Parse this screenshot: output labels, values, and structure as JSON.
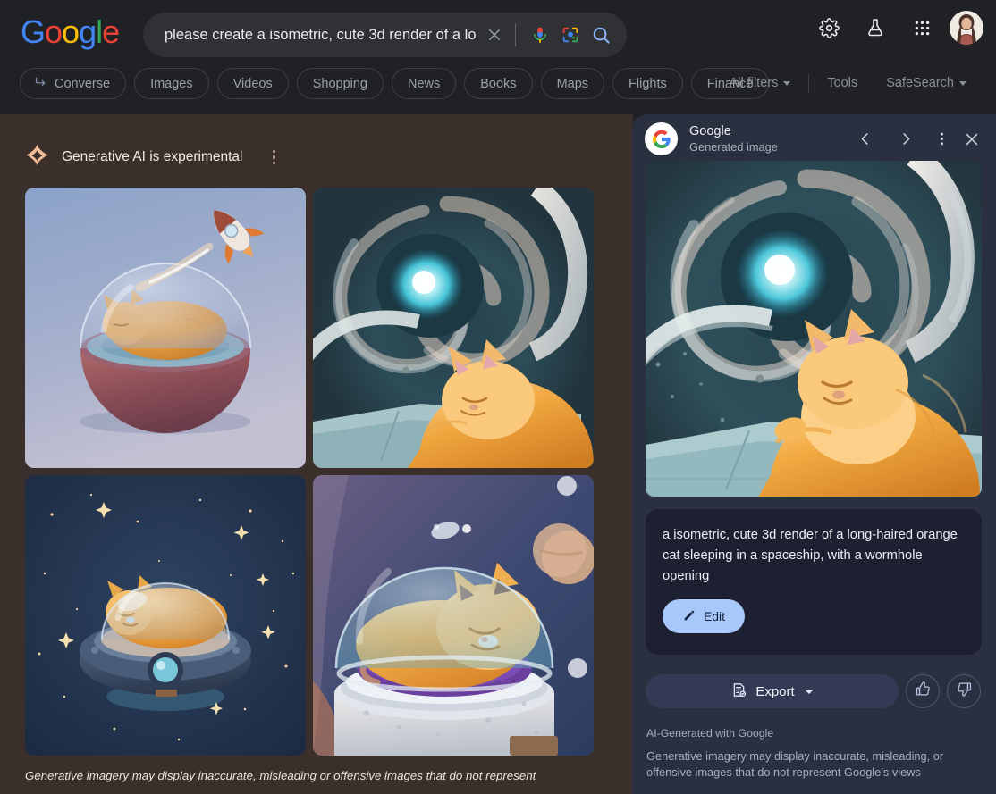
{
  "colors": {
    "topbar_bg": "#202124",
    "left_panel_bg": "#3a2f2a",
    "right_panel_bg": "#2b3040",
    "prompt_card_bg": "#1d2030",
    "edit_button_bg": "#a8c7fa",
    "export_button_bg": "#333b54",
    "accent_blue": "#8ab4f8",
    "sparkle_peach": "#f3bc97"
  },
  "topbar": {
    "logo": "Google",
    "search": {
      "value": "please create a isometric, cute 3d render of a lo",
      "placeholder": "Search",
      "clear_label": "×",
      "icons": [
        "clear-icon",
        "microphone-icon",
        "lens-icon",
        "search-icon"
      ]
    },
    "chips": [
      {
        "label": "Converse",
        "icon": "converse-arrow-icon"
      },
      {
        "label": "Images",
        "icon": ""
      },
      {
        "label": "Videos",
        "icon": ""
      },
      {
        "label": "Shopping",
        "icon": ""
      },
      {
        "label": "News",
        "icon": ""
      },
      {
        "label": "Books",
        "icon": ""
      },
      {
        "label": "Maps",
        "icon": ""
      },
      {
        "label": "Flights",
        "icon": ""
      },
      {
        "label": "Finance",
        "icon": ""
      }
    ],
    "controls": [
      {
        "label": "All filters",
        "caret": true
      },
      {
        "label": "Tools",
        "caret": false
      },
      {
        "label": "SafeSearch",
        "caret": true
      }
    ],
    "account_icons": [
      "settings-gear-icon",
      "labs-flask-icon",
      "google-apps-icon",
      "user-avatar"
    ]
  },
  "left_panel": {
    "header": {
      "icon": "sparkle-icon",
      "title": "Generative AI is experimental",
      "menu": "overflow-menu-icon"
    },
    "images": [
      {
        "alt": "cat sleeping in glass dome sphere with rocket flying above",
        "selected": false
      },
      {
        "alt": "cat sleeping by spaceship window with glowing teal wormhole",
        "selected": true
      },
      {
        "alt": "cat sleeping inside a blue flying saucer among stars",
        "selected": false
      },
      {
        "alt": "cat curled on purple cushion under glass dome with planets",
        "selected": false
      }
    ],
    "disclaimer": "Generative imagery may display inaccurate, misleading or offensive images that do not represent"
  },
  "right_panel": {
    "header": {
      "title": "Google",
      "subtitle": "Generated image",
      "prev": "chevron-left-icon",
      "next": "chevron-right-icon",
      "more": "overflow-menu-icon",
      "close": "close-icon"
    },
    "hero_alt": "cat sleeping by spaceship window with glowing teal wormhole",
    "prompt": "a isometric, cute 3d render of a long-haired orange cat sleeping in a spaceship, with a wormhole opening",
    "edit_label": "Edit",
    "edit_icon": "pencil-icon",
    "export_label": "Export",
    "export_icon": "export-doc-icon",
    "thumbs_up": "thumb-up-icon",
    "thumbs_down": "thumb-down-icon",
    "ai_label": "AI-Generated with Google",
    "ai_disclaimer": "Generative imagery may display inaccurate, misleading, or offensive images that do not represent Google’s views"
  }
}
